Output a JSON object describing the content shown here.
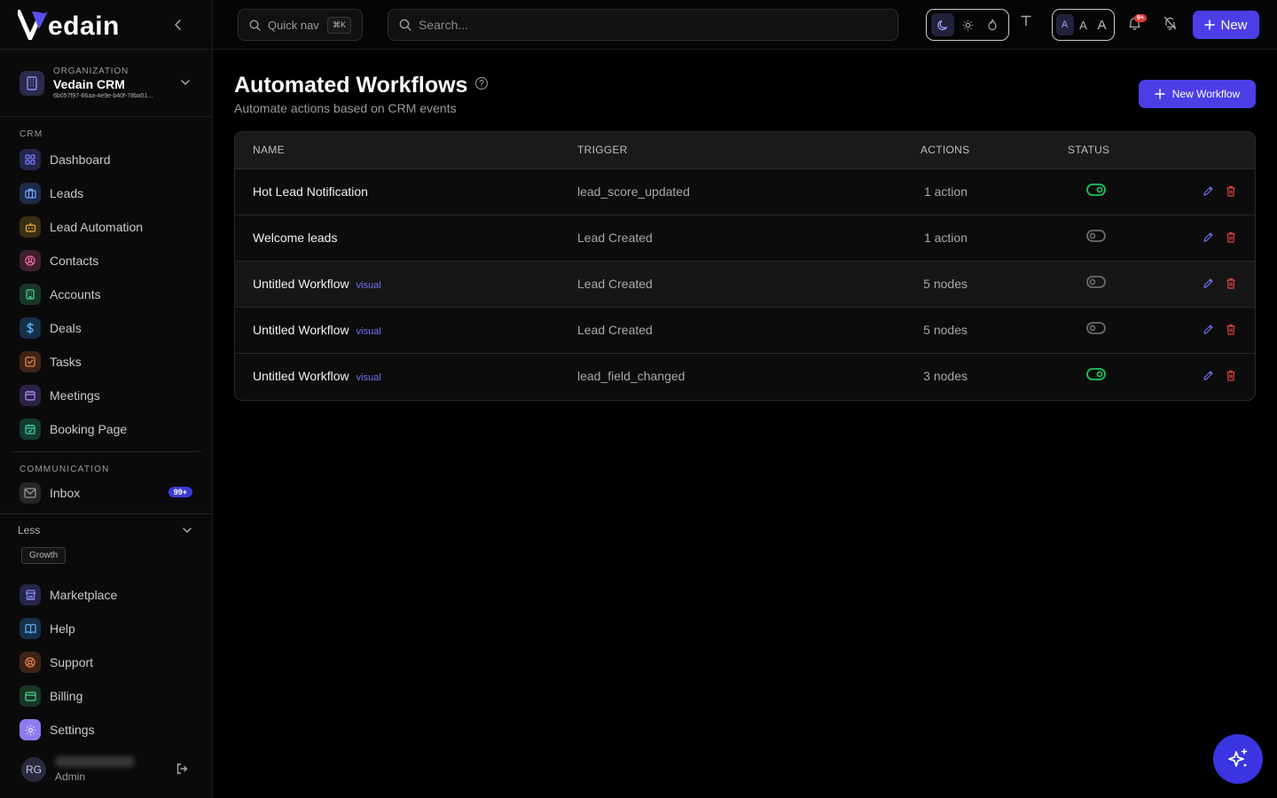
{
  "app": {
    "logo_text": "edain",
    "logo_letter": "V"
  },
  "org": {
    "caption": "ORGANIZATION",
    "name": "Vedain CRM",
    "id": "6b057f97-66aa-4e9e-b40f-78ba51..."
  },
  "sidebar": {
    "crm_label": "CRM",
    "crm_items": [
      {
        "label": "Dashboard",
        "icon": "dashboard-icon",
        "color": "#7b7fff",
        "bg": "#25264a"
      },
      {
        "label": "Leads",
        "icon": "briefcase-icon",
        "color": "#6fa8ff",
        "bg": "#1d2b48"
      },
      {
        "label": "Lead Automation",
        "icon": "bot-icon",
        "color": "#f2b23e",
        "bg": "#3a2e14"
      },
      {
        "label": "Contacts",
        "icon": "contact-icon",
        "color": "#ef6fa5",
        "bg": "#3d1f2e"
      },
      {
        "label": "Accounts",
        "icon": "building-icon",
        "color": "#4fd18b",
        "bg": "#173726"
      },
      {
        "label": "Deals",
        "icon": "dollar-icon",
        "color": "#5db4ff",
        "bg": "#17304a"
      },
      {
        "label": "Tasks",
        "icon": "checkbox-icon",
        "color": "#f2804a",
        "bg": "#3d2416"
      },
      {
        "label": "Meetings",
        "icon": "calendar-icon",
        "color": "#b28cff",
        "bg": "#2c2244"
      },
      {
        "label": "Booking Page",
        "icon": "calendar-check-icon",
        "color": "#3fd4a6",
        "bg": "#143a31"
      }
    ],
    "communication_label": "COMMUNICATION",
    "inbox": {
      "label": "Inbox",
      "badge": "99+"
    },
    "less_label": "Less",
    "growth_label": "Growth",
    "growth_items": [
      {
        "label": "Marketplace",
        "icon": "store-icon",
        "color": "#8c8fff",
        "bg": "#25264a"
      },
      {
        "label": "Help",
        "icon": "book-icon",
        "color": "#5db4ff",
        "bg": "#17304a"
      },
      {
        "label": "Support",
        "icon": "lifebuoy-icon",
        "color": "#f2804a",
        "bg": "#3d2416"
      },
      {
        "label": "Billing",
        "icon": "credit-card-icon",
        "color": "#4fd18b",
        "bg": "#173726"
      },
      {
        "label": "Settings",
        "icon": "gear-icon",
        "color": "#e8e6ff",
        "bg": "#8d7cf0"
      }
    ],
    "user": {
      "initials": "RG",
      "role": "Admin"
    }
  },
  "topbar": {
    "quicknav_label": "Quick nav",
    "quicknav_shortcut": "⌘K",
    "search_placeholder": "Search...",
    "font_sizes": [
      "A",
      "A",
      "A"
    ],
    "notification_badge": "9+",
    "new_label": "New"
  },
  "page": {
    "title": "Automated Workflows",
    "subtitle": "Automate actions based on CRM events",
    "new_workflow_label": "New Workflow"
  },
  "table": {
    "headers": {
      "name": "NAME",
      "trigger": "TRIGGER",
      "actions": "ACTIONS",
      "status": "STATUS"
    },
    "rows": [
      {
        "name": "Hot Lead Notification",
        "tag": "",
        "trigger": "lead_score_updated",
        "actions": "1 action",
        "enabled": true
      },
      {
        "name": "Welcome leads",
        "tag": "",
        "trigger": "Lead Created",
        "actions": "1 action",
        "enabled": false
      },
      {
        "name": "Untitled Workflow",
        "tag": "visual",
        "trigger": "Lead Created",
        "actions": "5 nodes",
        "enabled": false
      },
      {
        "name": "Untitled Workflow",
        "tag": "visual",
        "trigger": "Lead Created",
        "actions": "5 nodes",
        "enabled": false
      },
      {
        "name": "Untitled Workflow",
        "tag": "visual",
        "trigger": "lead_field_changed",
        "actions": "3 nodes",
        "enabled": true
      }
    ]
  },
  "colors": {
    "accent": "#4b3ee6",
    "toggle_on": "#22c55e",
    "toggle_off": "#6b6b6b",
    "edit": "#6f74f0",
    "delete": "#e0443b"
  }
}
